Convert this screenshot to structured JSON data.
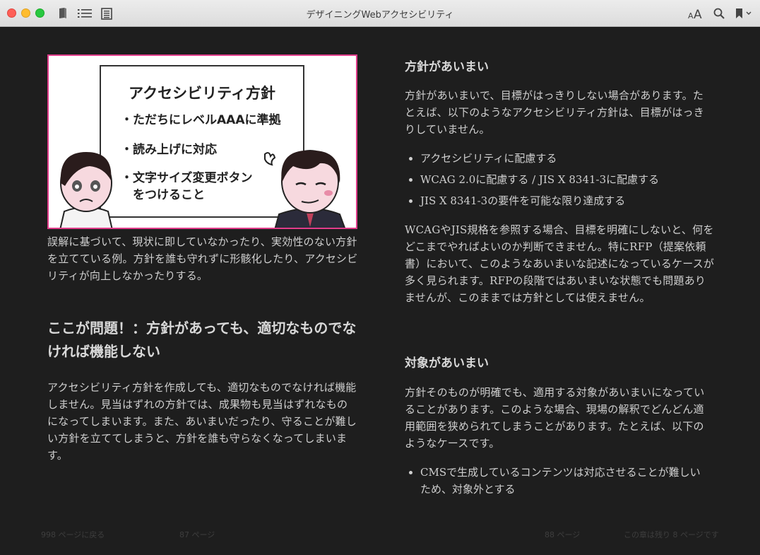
{
  "window": {
    "title": "デザイニングWebアクセシビリティ"
  },
  "toolbar": {
    "icons": [
      "library-icon",
      "toc-icon",
      "notes-icon",
      "font-size-icon",
      "search-icon",
      "bookmark-icon"
    ],
    "font_size_label": "AA"
  },
  "left_page": {
    "figure": {
      "board_title": "アクセシビリティ方針",
      "items": [
        "・ただちにレベルAAAに準拠",
        "・読み上げに対応",
        "・文字サイズ変更ボタン",
        "　をつけること"
      ]
    },
    "caption": "誤解に基づいて、現状に即していなかったり、実効性のない方針を立てている例。方針を誰も守れずに形骸化したり、アクセシビリティが向上しなかったりする。",
    "heading": "ここが問題！：方針があっても、適切なものでなければ機能しない",
    "body": "アクセシビリティ方針を作成しても、適切なものでなければ機能しません。見当はずれの方針では、成果物も見当はずれなものになってしまいます。また、あいまいだったり、守ることが難しい方針を立ててしまうと、方針を誰も守らなくなってしまいます。"
  },
  "right_page": {
    "section1": {
      "heading": "方針があいまい",
      "intro": "方針があいまいで、目標がはっきりしない場合があります。たとえば、以下のようなアクセシビリティ方針は、目標がはっきりしていません。",
      "bullets": [
        "アクセシビリティに配慮する",
        "WCAG 2.0に配慮する / JIS X 8341-3に配慮する",
        "JIS X 8341-3の要件を可能な限り達成する"
      ],
      "body": "WCAGやJIS規格を参照する場合、目標を明確にしないと、何をどこまでやればよいのか判断できません。特にRFP（提案依頼書）において、このようなあいまいな記述になっているケースが多く見られます。RFPの段階ではあいまいな状態でも問題ありませんが、このままでは方針としては使えません。"
    },
    "section2": {
      "heading": "対象があいまい",
      "intro": "方針そのものが明確でも、適用する対象があいまいになっていることがあります。このような場合、現場の解釈でどんどん適用範囲を狭められてしまうことがあります。たとえば、以下のようなケースです。",
      "bullets": [
        "CMSで生成しているコンテンツは対応させることが難しいため、対象外とする"
      ]
    }
  },
  "footer": {
    "back": "998 ページに戻る",
    "left_page_num": "87 ページ",
    "right_page_num": "88 ページ",
    "remaining": "この章は残り 8 ページです"
  },
  "colors": {
    "figure_border": "#e03c8a",
    "background": "#1e1e1e",
    "text": "#cfcfcf"
  }
}
